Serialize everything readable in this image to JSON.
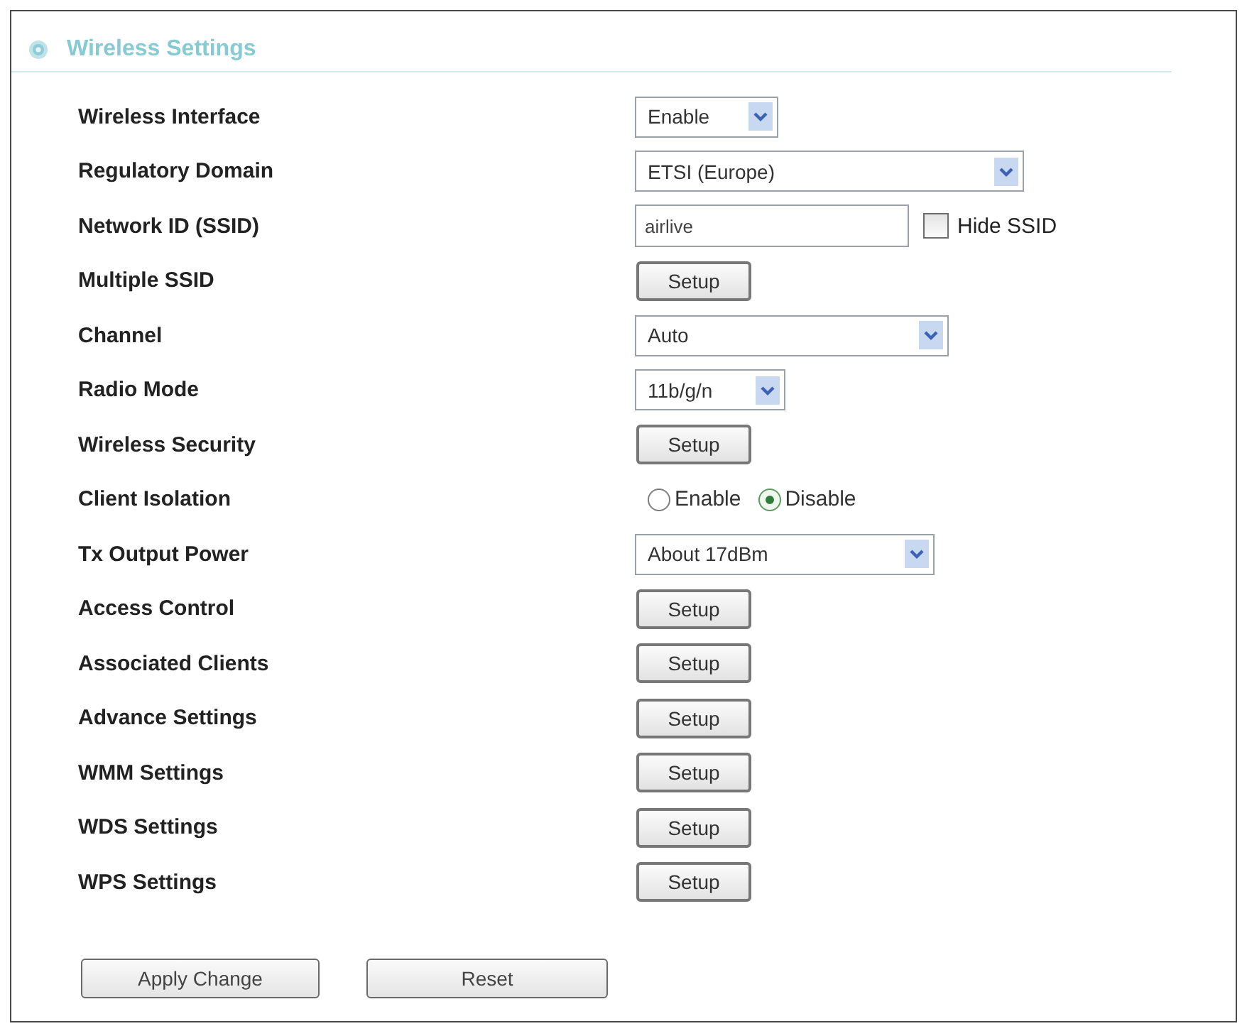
{
  "panel": {
    "title": "Wireless Settings"
  },
  "settings": [
    {
      "label": "Wireless Interface",
      "kind": "select",
      "value": "Enable"
    },
    {
      "label": "Regulatory Domain",
      "kind": "select",
      "value": "ETSI (Europe)"
    },
    {
      "label": "Network ID (SSID)",
      "kind": "text",
      "value": "airlive",
      "checkbox": {
        "label": "Hide SSID",
        "checked": false
      }
    },
    {
      "label": "Multiple SSID",
      "kind": "button",
      "button": "Setup"
    },
    {
      "label": "Channel",
      "kind": "select",
      "value": "Auto"
    },
    {
      "label": "Radio Mode",
      "kind": "select",
      "value": "11b/g/n"
    },
    {
      "label": "Wireless Security",
      "kind": "button",
      "button": "Setup"
    },
    {
      "label": "Client Isolation",
      "kind": "radio",
      "options": [
        {
          "label": "Enable",
          "selected": false
        },
        {
          "label": "Disable",
          "selected": true
        }
      ]
    },
    {
      "label": "Tx Output Power",
      "kind": "select",
      "value": "About 17dBm"
    },
    {
      "label": "Access Control",
      "kind": "button",
      "button": "Setup"
    },
    {
      "label": "Associated Clients",
      "kind": "button",
      "button": "Setup"
    },
    {
      "label": "Advance Settings",
      "kind": "button",
      "button": "Setup"
    },
    {
      "label": "WMM Settings",
      "kind": "button",
      "button": "Setup"
    },
    {
      "label": "WDS Settings",
      "kind": "button",
      "button": "Setup"
    },
    {
      "label": "WPS Settings",
      "kind": "button",
      "button": "Setup"
    }
  ],
  "actions": [
    "Apply Change",
    "Reset"
  ]
}
